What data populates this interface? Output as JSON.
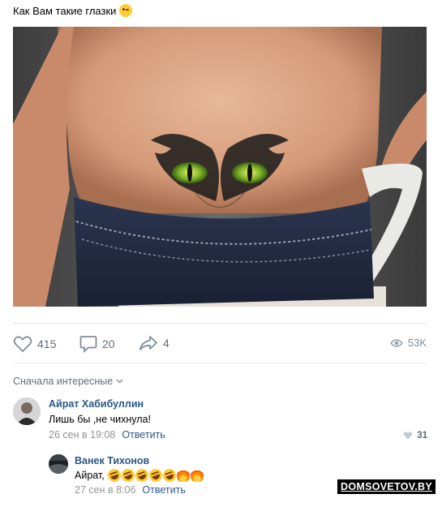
{
  "post": {
    "text": "Как Вам такие глазки",
    "emoji": "winking-face-emoji"
  },
  "photo": {
    "description_icon": "tattoo-photo"
  },
  "actions": {
    "likes": "415",
    "comments": "20",
    "shares": "4",
    "views": "53K"
  },
  "comments_sort": {
    "label": "Сначала интересные"
  },
  "comments": [
    {
      "author": "Айрат Хабибуллин",
      "text": "Лишь бы ,не чихнула!",
      "date": "26 сен в 19:08",
      "reply_label": "Ответить",
      "likes": "31"
    },
    {
      "author": "Ванек Тихонов",
      "text": "Айрат,",
      "emojis": [
        "rolling-laughing",
        "rolling-laughing",
        "rolling-laughing",
        "rolling-laughing",
        "rolling-laughing",
        "fire",
        "fire"
      ],
      "date": "27 сен в 8:06",
      "reply_label": "Ответить"
    }
  ],
  "watermark": "DOMSOVETOV.BY",
  "colors": {
    "link": "#2a5885",
    "muted": "#626d7a",
    "divider": "#e7e8ec"
  }
}
